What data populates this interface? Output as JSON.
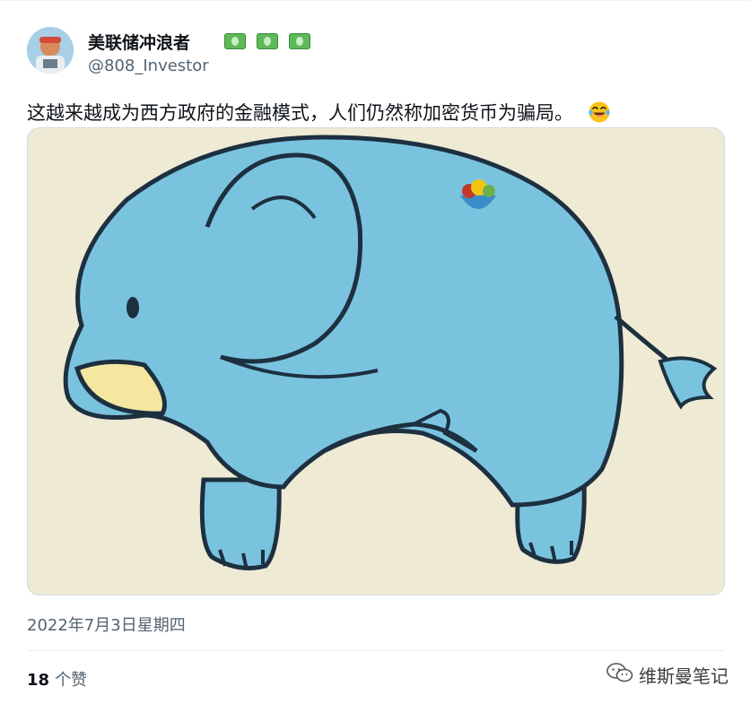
{
  "author": {
    "display_name": "美联储冲浪者",
    "handle": "@808_Investor",
    "name_emojis": [
      "money-with-wings-icon",
      "money-with-wings-icon",
      "money-with-wings-icon"
    ]
  },
  "tweet": {
    "text": "这越来越成为西方政府的金融模式，人们仍然称加密货币为骗局。",
    "trailing_emoji": "face-with-tears-of-joy-icon",
    "timestamp": "2022年7月3日星期四"
  },
  "engagement": {
    "likes_count": "18",
    "likes_label": "个赞"
  },
  "watermark": {
    "text": "维斯曼笔记"
  },
  "colors": {
    "elephant_body": "#7ac3df",
    "image_background": "#eeead3",
    "tusk": "#f5e6a0",
    "outline": "#1d3040",
    "secondary_text": "#536471"
  }
}
